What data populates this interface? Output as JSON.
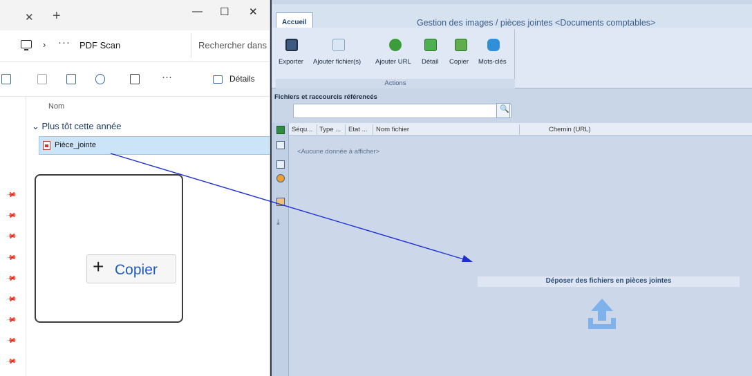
{
  "explorer": {
    "tab": {
      "close_icon": "close-icon",
      "new_tab_icon": "plus-icon"
    },
    "window_controls": {
      "minimize": "—",
      "maximize": "☐",
      "close": "✕"
    },
    "address": {
      "ellipsis": "···",
      "path": "PDF Scan",
      "search_placeholder": "Rechercher dans"
    },
    "toolbar": {
      "more": "···",
      "details_label": "Détails"
    },
    "list": {
      "column_name": "Nom",
      "group_label": "Plus tôt cette année",
      "file_name": "Pièce_jointe"
    }
  },
  "app": {
    "tab_label": "Accueil",
    "title": "Gestion des images / pièces jointes <Documents comptables>",
    "ribbon": {
      "buttons": [
        {
          "label": "Exporter"
        },
        {
          "label": "Ajouter fichier(s)"
        },
        {
          "label": "Ajouter URL"
        },
        {
          "label": "Détail"
        },
        {
          "label": "Copier"
        },
        {
          "label": "Mots-clés"
        }
      ],
      "group_title": "Actions"
    },
    "section_title": "Fichiers et raccourcis référencés",
    "grid": {
      "columns": [
        "Séqu...",
        "Type ...",
        "Etat ...",
        "Nom fichier",
        "Chemin (URL)"
      ],
      "empty_message": "<Aucune donnée à afficher>"
    },
    "drag": {
      "plus": "+",
      "label": "Copier"
    },
    "dropzone_label": "Déposer des fichiers en pièces jointes"
  },
  "colors": {
    "accent": "#1d5bbf",
    "upload_icon": "#7fb1ea",
    "drag_arrow": "#1f2fd1"
  }
}
